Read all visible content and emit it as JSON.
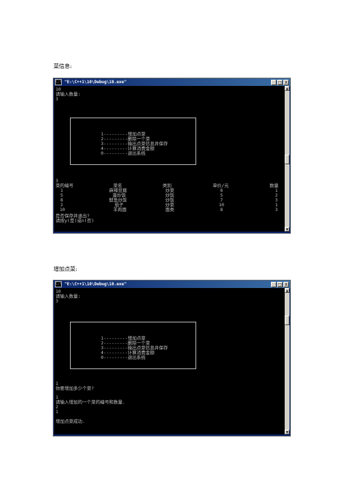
{
  "captions": {
    "first": "菜信息:",
    "second": "增加点菜:"
  },
  "window": {
    "title": "\"E:\\C++1\\10\\Debug\\10.exe\"",
    "icon": "console-icon",
    "buttons": [
      "_",
      "□",
      "X"
    ]
  },
  "menu": {
    "items": [
      "1---------增加点菜",
      "2---------删除一个菜",
      "3---------输出点菜信息并保存",
      "4---------计算消费金额",
      "0---------退出系统"
    ]
  },
  "console1": {
    "top_lines": [
      "10",
      "请输入数量:",
      "3"
    ],
    "after_menu": "3",
    "table_headers": [
      "菜的编号",
      "菜名",
      "类别",
      "单价/元",
      "数量"
    ],
    "rows": [
      [
        "1",
        "麻辣豆腐",
        "炒菜",
        "8",
        "1"
      ],
      [
        "5",
        "蛋炒饭",
        "炒饭",
        "5",
        "2"
      ],
      [
        "8",
        "鱿鱼炒饭",
        "炒饭",
        "7",
        "3"
      ],
      [
        "2",
        "茄子",
        "炒菜",
        "10",
        "1"
      ],
      [
        "10",
        "羊肉面",
        "面类",
        "8",
        "3"
      ]
    ],
    "prompt_lines": [
      "是否保存并退出?",
      "请按y(是)或n(否)"
    ]
  },
  "console2": {
    "top_lines": [
      "10",
      "请输入数量:",
      "3"
    ],
    "bottom_lines": [
      "1",
      "你要增加多少个菜?",
      "1",
      "请输入增加的一个菜的编号和数量.",
      "2",
      "1",
      "增加点菜成功."
    ]
  }
}
